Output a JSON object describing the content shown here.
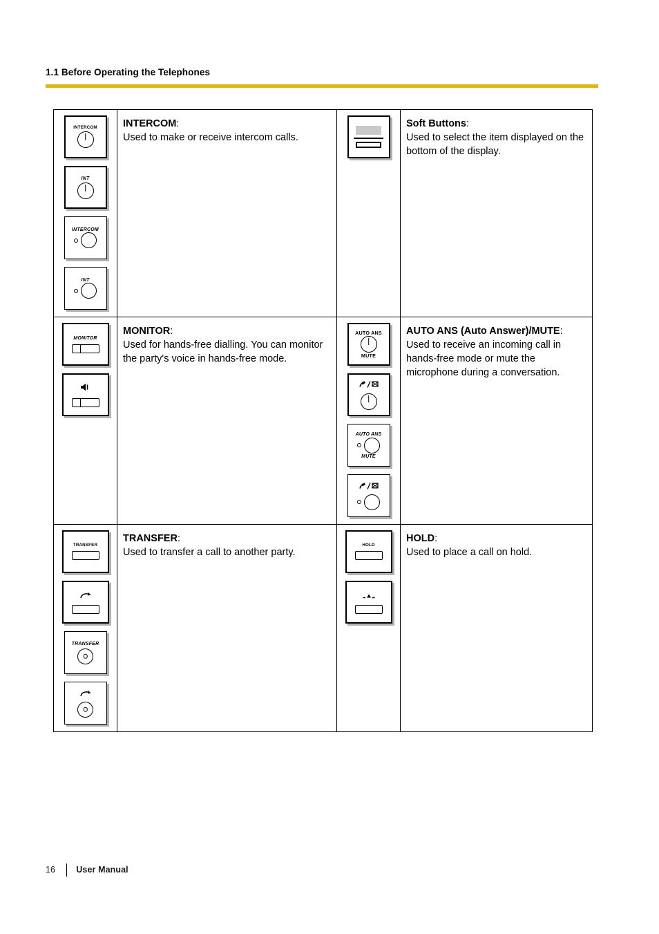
{
  "header": {
    "section_title": "1.1 Before Operating the Telephones",
    "rule_color": "#ddb80b"
  },
  "footer": {
    "page_number": "16",
    "label": "User Manual"
  },
  "table": {
    "rows": [
      {
        "left": {
          "title": "INTERCOM",
          "colon": ":",
          "body": "Used to make or receive intercom calls.",
          "keys": [
            {
              "icon": "intercom-key-round-notch",
              "label_top": "INTERCOM",
              "label_bottom": ""
            },
            {
              "icon": "int-key-round-notch",
              "label_top": "INT",
              "label_bottom": ""
            },
            {
              "icon": "intercom-key-led-round",
              "label_top": "INTERCOM",
              "label_bottom": ""
            },
            {
              "icon": "int-key-led-round",
              "label_top": "INT",
              "label_bottom": ""
            }
          ]
        },
        "right": {
          "title": "Soft Buttons",
          "colon": ":",
          "body": "Used to select the item displayed on the bottom of the display.",
          "keys": [
            {
              "icon": "soft-buttons-display-key",
              "label_top": "",
              "label_bottom": ""
            }
          ]
        }
      },
      {
        "left": {
          "title": "MONITOR",
          "colon": ":",
          "body": "Used for hands-free dialling. You can monitor the party's voice in hands-free mode.",
          "keys": [
            {
              "icon": "monitor-key-bar",
              "label_top": "MONITOR",
              "label_bottom": ""
            },
            {
              "icon": "monitor-key-speaker-bar",
              "label_top": "speaker-glyph",
              "label_bottom": ""
            }
          ]
        },
        "right": {
          "title": "AUTO ANS (Auto Answer)/MUTE",
          "colon": ":",
          "body": "Used to receive an incoming call in hands-free mode or mute the microphone during a conversation.",
          "keys": [
            {
              "icon": "auto-ans-mute-key-round-notch",
              "label_top": "AUTO ANS",
              "label_bottom": "MUTE"
            },
            {
              "icon": "auto-ans-mute-glyph-key-round-notch",
              "label_top": "mic-mail-glyph",
              "label_bottom": ""
            },
            {
              "icon": "auto-ans-mute-key-led-round",
              "label_top": "AUTO ANS",
              "label_bottom": "MUTE"
            },
            {
              "icon": "auto-ans-mute-glyph-key-led-round",
              "label_top": "mic-mail-glyph",
              "label_bottom": ""
            }
          ]
        }
      },
      {
        "left": {
          "title": "TRANSFER",
          "colon": ":",
          "body": "Used to transfer a call to another party.",
          "keys": [
            {
              "icon": "transfer-key-bar",
              "label_top": "TRANSFER",
              "label_bottom": ""
            },
            {
              "icon": "transfer-key-arrow-bar",
              "label_top": "transfer-arrow-glyph",
              "label_bottom": ""
            },
            {
              "icon": "transfer-key-round-dot",
              "label_top": "TRANSFER",
              "label_bottom": ""
            },
            {
              "icon": "transfer-key-arrow-round-dot",
              "label_top": "transfer-arrow-glyph",
              "label_bottom": ""
            }
          ]
        },
        "right": {
          "title": "HOLD",
          "colon": ":",
          "body": "Used to place a call on hold.",
          "keys": [
            {
              "icon": "hold-key-bar",
              "label_top": "HOLD",
              "label_bottom": ""
            },
            {
              "icon": "hold-key-glyph-bar",
              "label_top": "hold-glyph",
              "label_bottom": ""
            }
          ]
        }
      }
    ]
  }
}
